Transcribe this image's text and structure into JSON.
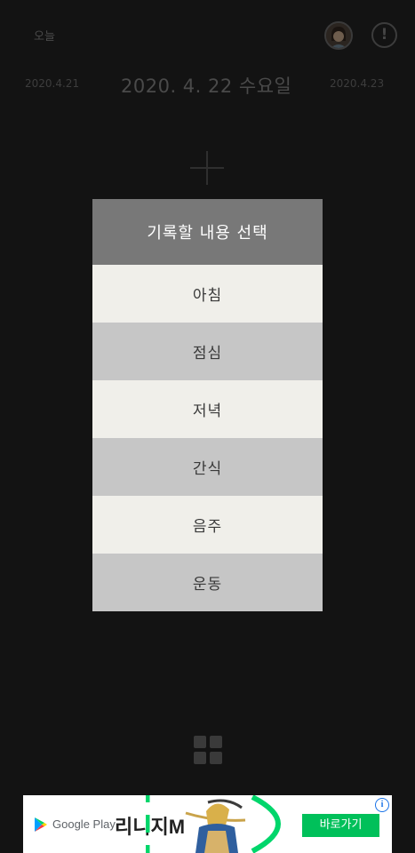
{
  "header": {
    "today_label": "오늘",
    "avatar_icon": "user-avatar",
    "info_icon": "exclamation-icon",
    "info_symbol": "!"
  },
  "date_nav": {
    "prev": "2020.4.21",
    "current": "2020. 4. 22 수요일",
    "next": "2020.4.23"
  },
  "main": {
    "add_icon": "plus-icon",
    "grid_icon": "grid-icon"
  },
  "dialog": {
    "title": "기록할 내용 선택",
    "options": [
      "아침",
      "점심",
      "저녁",
      "간식",
      "음주",
      "운동"
    ]
  },
  "ad": {
    "store": "Google Play",
    "title": "리니지M",
    "cta": "바로가기",
    "info_symbol": "i"
  },
  "colors": {
    "overlay_bg": "#131313",
    "dialog_header": "#787878",
    "option_light": "#f0efea",
    "option_dark": "#c6c6c6",
    "ad_cta": "#00c05a"
  }
}
